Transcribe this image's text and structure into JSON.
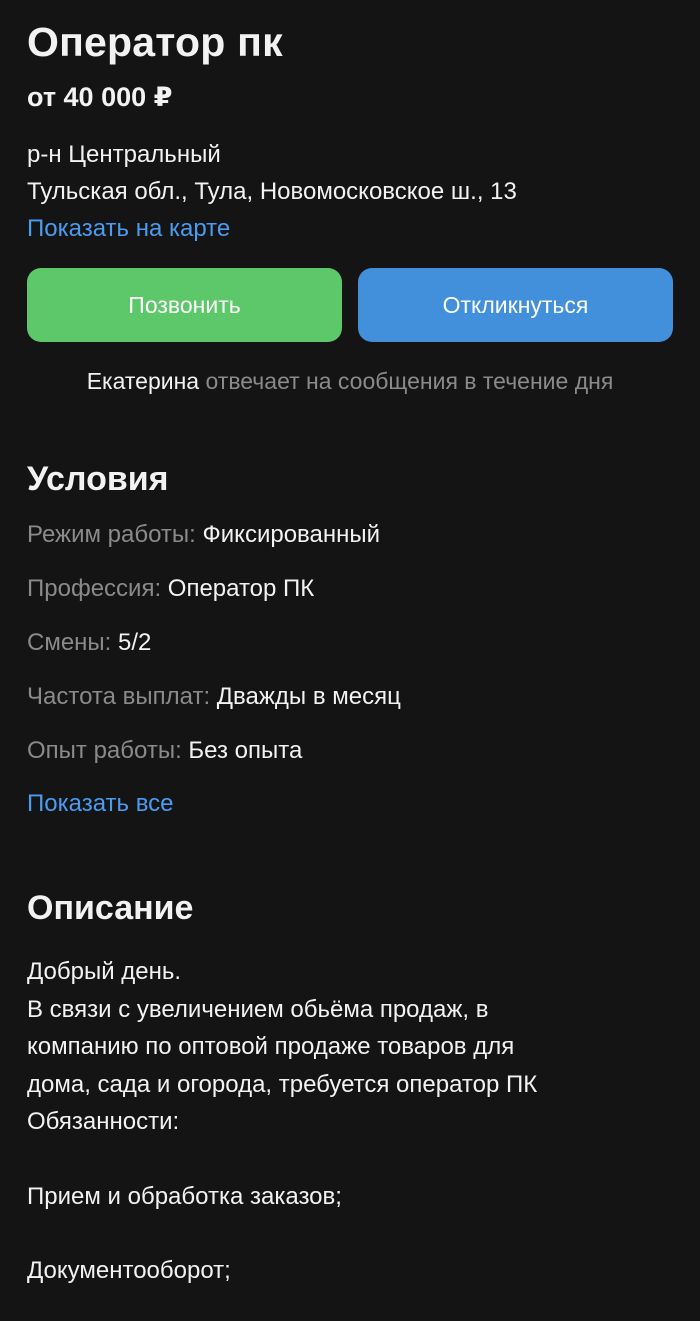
{
  "vacancy": {
    "title": "Оператор пк",
    "salary": "от 40 000 ₽",
    "district": "р-н Центральный",
    "address": "Тульская обл., Тула, Новомосковское ш., 13",
    "map_link": "Показать на карте"
  },
  "actions": {
    "call_label": "Позвонить",
    "reply_label": "Откликнуться",
    "call_color": "#5cc869",
    "reply_color": "#4290dc"
  },
  "responder": {
    "name": "Екатерина",
    "text": "отвечает на сообщения в течение дня"
  },
  "conditions": {
    "title": "Условия",
    "items": [
      {
        "label": "Режим работы:",
        "value": "Фиксированный"
      },
      {
        "label": "Профессия:",
        "value": "Оператор ПК"
      },
      {
        "label": "Смены:",
        "value": "5/2"
      },
      {
        "label": "Частота выплат:",
        "value": "Дважды в месяц"
      },
      {
        "label": "Опыт работы:",
        "value": "Без опыта"
      }
    ],
    "show_all": "Показать все"
  },
  "description": {
    "title": "Описание",
    "lines": [
      "Добрый день.",
      "В связи с увеличением обьёма продаж, в",
      "компанию по оптовой продаже товаров для",
      "дома, сада и огорода, требуется оператор ПК",
      "Обязанности:",
      "Прием и обработка заказов;",
      "Документооборот;"
    ]
  },
  "colors": {
    "background": "#141414",
    "link": "#4a9cf0",
    "muted_text": "#8a8a8a"
  }
}
